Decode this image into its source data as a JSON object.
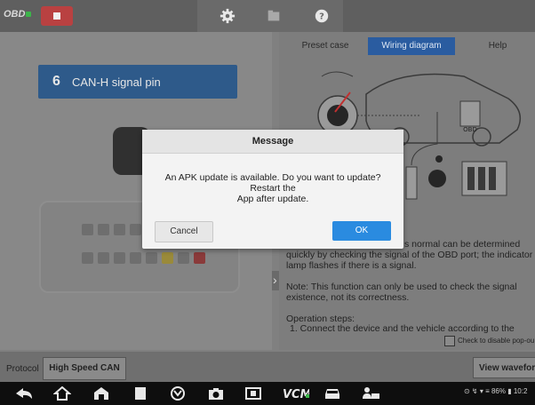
{
  "app": {
    "logo": "OBD"
  },
  "tabs": [
    {
      "label": "Preset case"
    },
    {
      "label": "Wiring diagram"
    },
    {
      "label": "Help"
    }
  ],
  "signal": {
    "number": "6",
    "label": "CAN-H signal pin"
  },
  "help": {
    "line1_partial": "s normal can be determined",
    "line2": "quickly by checking the signal of the OBD port; the indicator",
    "line3": "lamp flashes if there is a signal.",
    "note1": "Note: This function can only be used to check the signal",
    "note2": "existence, not its correctness.",
    "steps_title": "Operation steps:",
    "step1": "1. Connect the device and the vehicle according to the",
    "checkbox_label": "Check to disable pop-ou"
  },
  "diagram": {
    "obd_label": "OBD"
  },
  "bottom": {
    "protocol_label": "Protocol",
    "protocol_value": "High Speed CAN",
    "view_waveform": "View waveform"
  },
  "dialog": {
    "title": "Message",
    "message_line1": "An APK update is available. Do you want to update? Restart the",
    "message_line2": "App after update.",
    "cancel_label": "Cancel",
    "ok_label": "OK"
  },
  "statusbar": {
    "text": "⊙ ↯ ▾ ≡ 86% ▮ 10:2"
  },
  "colors": {
    "accent_blue": "#2a8be0",
    "tab_active": "#2a5ca0",
    "stop_red": "#b94141",
    "logo_green": "#3cb54a"
  },
  "icons": [
    "stop-icon",
    "gear-icon",
    "folder-icon",
    "help-icon",
    "back-icon",
    "home-icon",
    "house-icon",
    "recents-icon",
    "browser-icon",
    "camera-icon",
    "screen-icon",
    "vcm-icon",
    "car-icon",
    "car-user-icon"
  ]
}
